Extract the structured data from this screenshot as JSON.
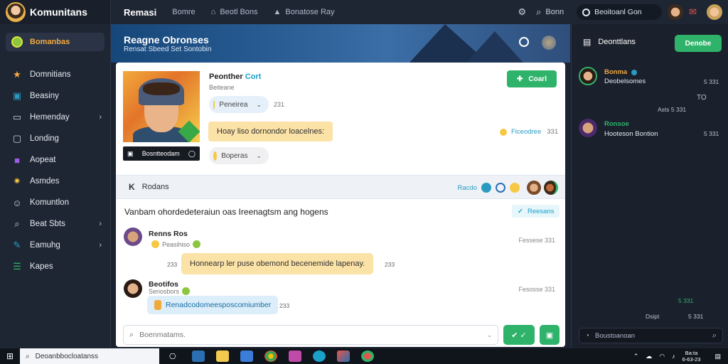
{
  "app": {
    "name": "Komunitans"
  },
  "sidebar": {
    "active": {
      "label": "Bomanbas"
    },
    "items": [
      {
        "label": "Domnitians",
        "icon": "star-icon",
        "chevron": false
      },
      {
        "label": "Beasiny",
        "icon": "device-icon",
        "chevron": false
      },
      {
        "label": "Hemenday",
        "icon": "monitor-icon",
        "chevron": true
      },
      {
        "label": "Londing",
        "icon": "window-icon",
        "chevron": false
      },
      {
        "label": "Aopeat",
        "icon": "purple-square-icon",
        "chevron": false
      },
      {
        "label": "Asmdes",
        "icon": "gear-star-icon",
        "chevron": false
      },
      {
        "label": "Komuntlon",
        "icon": "person-icon",
        "chevron": false
      },
      {
        "label": "Beat Sbts",
        "icon": "search-icon",
        "chevron": true
      },
      {
        "label": "Eamuhg",
        "icon": "wrench-icon",
        "chevron": true
      },
      {
        "label": "Kapes",
        "icon": "list-icon",
        "chevron": false
      }
    ]
  },
  "topbar": {
    "title": "Remasi",
    "nav": [
      "Bomre",
      "Beotl Bons",
      "Bonatose Ray"
    ],
    "search_label": "Bonn",
    "status_label": "Beoitoanl Gon"
  },
  "banner": {
    "title": "Reagne Obronses",
    "subtitle": "Rensat Sbeed Set Sontobin"
  },
  "post": {
    "player_name": "Peonther",
    "player_accent": "Cort",
    "player_sub": "Beiteane",
    "image_caption": "Bosntteodam",
    "chip1_label": "Peneirea",
    "chip1_time": "231",
    "message": "Hoay liso dornondor loacelnes:",
    "chip2_label": "Boperas",
    "join_label": "Coarl",
    "status_label": "Ficeodree",
    "status_time": "331"
  },
  "section": {
    "back": "K",
    "title": "Rodans",
    "right_label": "Racdo"
  },
  "topic": {
    "text": "Vanbam ohordedeteraiun oas Ireenagtsm ang hogens",
    "tag": "Reesans"
  },
  "comments": [
    {
      "name": "Renns Ros",
      "sub": "Peasihiso",
      "time": "Fessese 331",
      "bubble_num": "233",
      "bubble": "Honnearp ler puse obemond becenemide lapenay.",
      "after": "233"
    },
    {
      "name": "Beotifos",
      "sub": "Senosbors",
      "time": "Fesosse 331",
      "bubble": "Renadcodomeesposcomiumber",
      "after": "233"
    }
  ],
  "composer": {
    "placeholder": "Boenmatams."
  },
  "right_panel": {
    "header": "Deonttlans",
    "button": "Denobe",
    "msgs": [
      {
        "name": "Bonma",
        "text": "Deobelsomes",
        "time": "5 331",
        "meta": "TO",
        "meta2": "Asts 5 331"
      },
      {
        "name": "Ronsoe",
        "text": "Hooteson Bontion",
        "time": "5 331"
      }
    ],
    "bottom_time": "5 331",
    "bottom_label": "Dsipt",
    "bottom_time2": "5 331",
    "search_placeholder": "Boustoanoan"
  },
  "taskbar": {
    "search": "Deoanbbocloatanss",
    "clock_time": "Ba:ta",
    "clock_date": "6-63-23"
  },
  "colors": {
    "accent_green": "#2fb36b",
    "accent_orange": "#f1a941",
    "accent_blue": "#1aa0c9"
  }
}
